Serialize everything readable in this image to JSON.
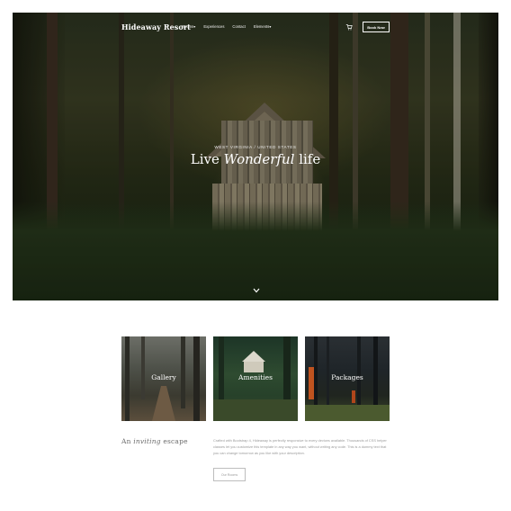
{
  "nav": {
    "brand": "Hideaway Resort",
    "links": [
      {
        "label": "Rooms"
      },
      {
        "label": "Experiences"
      },
      {
        "label": "Contact"
      },
      {
        "label": "Elements"
      }
    ],
    "book_label": "Book Now",
    "cart_icon": "cart-icon"
  },
  "hero": {
    "subtitle": "WEST VIRGINIA / UNITED STATES",
    "title_pre": "Live ",
    "title_em": "Wonderful",
    "title_post": " life",
    "scroll_icon": "chevron-down-icon"
  },
  "cards": [
    {
      "label": "Gallery"
    },
    {
      "label": "Amenities"
    },
    {
      "label": "Packages"
    }
  ],
  "intro": {
    "heading_pre": "An ",
    "heading_em": "inviting",
    "heading_post": " escape",
    "text": "Crafted with Bootstrap 4, Hideaway is perfectly responsive to every devices available. Thousands of CSS helper classes let you customize this template in any way you want, without writing any code. This is a dummy text that you can change tomorrow as you like with your description.",
    "button_label": "Our Rooms"
  }
}
